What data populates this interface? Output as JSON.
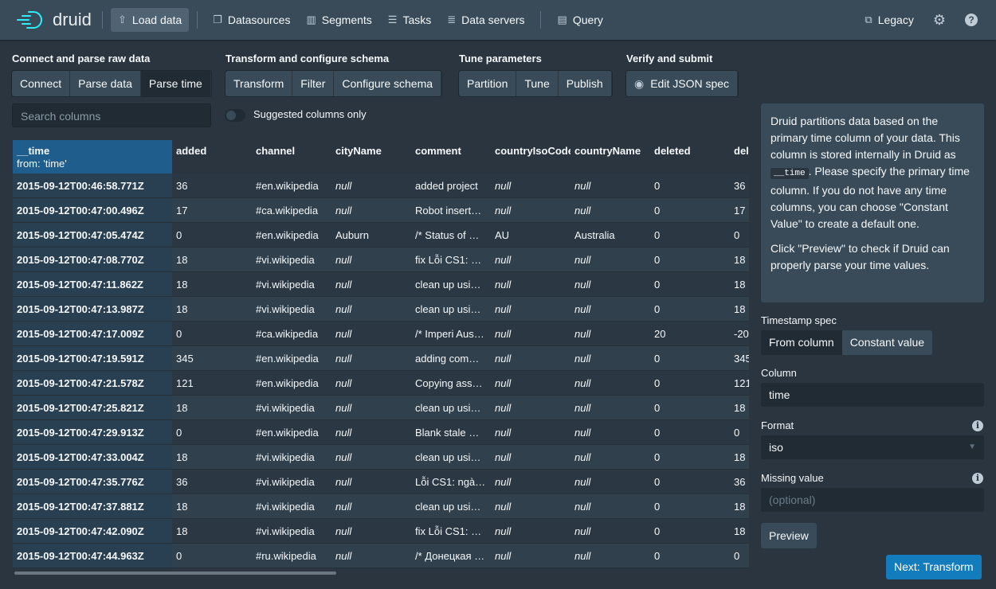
{
  "nav": {
    "brand": "druid",
    "items": [
      {
        "label": "Load data",
        "icon": "cloud-upload-icon",
        "active": true
      },
      {
        "label": "Datasources",
        "icon": "multi-select-icon"
      },
      {
        "label": "Segments",
        "icon": "stacked-chart-icon"
      },
      {
        "label": "Tasks",
        "icon": "gantt-chart-icon"
      },
      {
        "label": "Data servers",
        "icon": "database-icon"
      },
      {
        "label": "Query",
        "icon": "application-icon"
      }
    ],
    "legacy": "Legacy"
  },
  "steps": [
    {
      "title": "Connect and parse raw data",
      "items": [
        "Connect",
        "Parse data",
        "Parse time"
      ]
    },
    {
      "title": "Transform and configure schema",
      "items": [
        "Transform",
        "Filter",
        "Configure schema"
      ]
    },
    {
      "title": "Tune parameters",
      "items": [
        "Partition",
        "Tune",
        "Publish"
      ]
    },
    {
      "title": "Verify and submit",
      "items": [
        "Edit JSON spec"
      ]
    }
  ],
  "active_step": "Parse time",
  "search": {
    "placeholder": "Search columns"
  },
  "toggle": {
    "label": "Suggested columns only",
    "on": false
  },
  "table": {
    "time_header": "__time",
    "time_sub": "from: 'time'",
    "columns": [
      "added",
      "channel",
      "cityName",
      "comment",
      "countryIsoCode",
      "countryName",
      "deleted",
      "delta"
    ],
    "rows": [
      [
        "2015-09-12T00:46:58.771Z",
        "36",
        "#en.wikipedia",
        "null",
        "added project",
        "null",
        "null",
        "0",
        "36"
      ],
      [
        "2015-09-12T00:47:00.496Z",
        "17",
        "#ca.wikipedia",
        "null",
        "Robot inserta…",
        "null",
        "null",
        "0",
        "17"
      ],
      [
        "2015-09-12T00:47:05.474Z",
        "0",
        "#en.wikipedia",
        "Auburn",
        "/* Status of …",
        "AU",
        "Australia",
        "0",
        "0"
      ],
      [
        "2015-09-12T00:47:08.770Z",
        "18",
        "#vi.wikipedia",
        "null",
        "fix Lỗi CS1: n…",
        "null",
        "null",
        "0",
        "18"
      ],
      [
        "2015-09-12T00:47:11.862Z",
        "18",
        "#vi.wikipedia",
        "null",
        "clean up usi…",
        "null",
        "null",
        "0",
        "18"
      ],
      [
        "2015-09-12T00:47:13.987Z",
        "18",
        "#vi.wikipedia",
        "null",
        "clean up usi…",
        "null",
        "null",
        "0",
        "18"
      ],
      [
        "2015-09-12T00:47:17.009Z",
        "0",
        "#ca.wikipedia",
        "null",
        "/* Imperi Aus…",
        "null",
        "null",
        "20",
        "-20"
      ],
      [
        "2015-09-12T00:47:19.591Z",
        "345",
        "#en.wikipedia",
        "null",
        "adding com…",
        "null",
        "null",
        "0",
        "345"
      ],
      [
        "2015-09-12T00:47:21.578Z",
        "121",
        "#en.wikipedia",
        "null",
        "Copying ass…",
        "null",
        "null",
        "0",
        "121"
      ],
      [
        "2015-09-12T00:47:25.821Z",
        "18",
        "#vi.wikipedia",
        "null",
        "clean up usi…",
        "null",
        "null",
        "0",
        "18"
      ],
      [
        "2015-09-12T00:47:29.913Z",
        "0",
        "#en.wikipedia",
        "null",
        "Blank stale …",
        "null",
        "null",
        "0",
        "0"
      ],
      [
        "2015-09-12T00:47:33.004Z",
        "18",
        "#vi.wikipedia",
        "null",
        "clean up usi…",
        "null",
        "null",
        "0",
        "18"
      ],
      [
        "2015-09-12T00:47:35.776Z",
        "36",
        "#vi.wikipedia",
        "null",
        "Lỗi CS1: ngà…",
        "null",
        "null",
        "0",
        "36"
      ],
      [
        "2015-09-12T00:47:37.881Z",
        "18",
        "#vi.wikipedia",
        "null",
        "clean up usi…",
        "null",
        "null",
        "0",
        "18"
      ],
      [
        "2015-09-12T00:47:42.090Z",
        "18",
        "#vi.wikipedia",
        "null",
        "fix Lỗi CS1: n…",
        "null",
        "null",
        "0",
        "18"
      ],
      [
        "2015-09-12T00:47:44.963Z",
        "0",
        "#ru.wikipedia",
        "null",
        "/* Донецкая …",
        "null",
        "null",
        "0",
        "0"
      ]
    ]
  },
  "info": {
    "p1a": "Druid partitions data based on the primary time column of your data. This column is stored internally in Druid as ",
    "code": "__time",
    "p1b": ". Please specify the primary time column. If you do not have any time columns, you can choose \"Constant Value\" to create a default one.",
    "p2": "Click \"Preview\" to check if Druid can properly parse your time values."
  },
  "form": {
    "timestamp_spec_label": "Timestamp spec",
    "spec_options": [
      "From column",
      "Constant value"
    ],
    "spec_selected": "From column",
    "column_label": "Column",
    "column_value": "time",
    "format_label": "Format",
    "format_value": "iso",
    "missing_label": "Missing value",
    "missing_placeholder": "(optional)",
    "preview": "Preview",
    "next": "Next: Transform"
  },
  "colors": {
    "accent": "#137cbd",
    "time_header": "#1f5e8c",
    "bg": "#2a3540"
  }
}
